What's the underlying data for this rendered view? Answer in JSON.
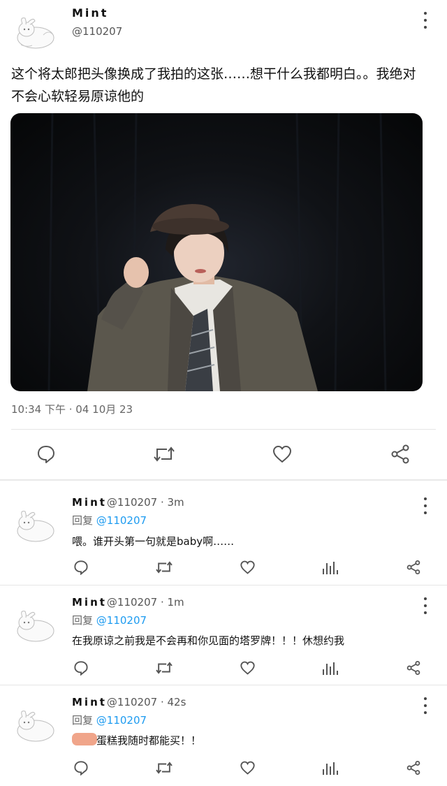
{
  "tweet": {
    "name": "Mint",
    "handle": "@110207",
    "text": "这个将太郎把头像换成了我拍的这张……想干什么我都明白。。我绝对不会心软轻易原谅他的",
    "timestamp": "10:34 下午 · 04 10月 23",
    "actions": [
      "comment-icon",
      "retweet-icon",
      "heart-icon",
      "share-icon"
    ]
  },
  "replies": [
    {
      "name": "Mint",
      "handle": "@110207",
      "time": "· 3m",
      "reply_label": "回复",
      "reply_to": "@110207",
      "text": "喂。谁开头第一句就是baby啊……"
    },
    {
      "name": "Mint",
      "handle": "@110207",
      "time": "· 1m",
      "reply_label": "回复",
      "reply_to": "@110207",
      "text": "在我原谅之前我是不会再和你见面的塔罗牌！！！休想约我"
    },
    {
      "name": "Mint",
      "handle": "@110207",
      "time": "· 42s",
      "reply_label": "回复",
      "reply_to": "@110207",
      "text": "蛋糕我随时都能买！！"
    }
  ],
  "colors": {
    "link": "#1d9bf0",
    "text": "#0f1419",
    "muted": "#666666"
  }
}
